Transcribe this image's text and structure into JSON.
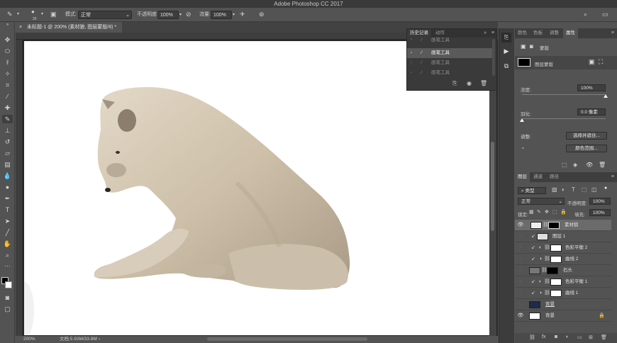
{
  "app": {
    "title": "Adobe Photoshop CC 2017"
  },
  "options": {
    "brush_size": "25",
    "mode_label": "模式:",
    "mode_value": "正常",
    "opacity_label": "不透明度:",
    "opacity_value": "100%",
    "flow_label": "流量:",
    "flow_value": "100%"
  },
  "document": {
    "tab_title": "未标题-1 @ 200% (素材狼, 图层蒙版/8) *",
    "zoom": "200%",
    "doc_info": "文档:5.93M/33.8M"
  },
  "history": {
    "tabs": [
      "历史记录",
      "动作"
    ],
    "items": [
      {
        "label": "画笔工具",
        "selected": false
      },
      {
        "label": "画笔工具",
        "selected": true
      },
      {
        "label": "画笔工具",
        "selected": false
      },
      {
        "label": "画笔工具",
        "selected": false
      }
    ]
  },
  "properties": {
    "tabs": [
      "颜色",
      "色板",
      "调整",
      "属性"
    ],
    "mask_title": "蒙版",
    "layer_mask_label": "图层蒙版",
    "density_label": "浓度:",
    "density_value": "100%",
    "feather_label": "羽化:",
    "feather_value": "0.0 像素",
    "adjust_label": "调整:",
    "select_and_mask": "选择并遮住...",
    "color_range": "颜色范围...",
    "density_level": 1.0,
    "feather_level": 0.0
  },
  "layers_panel": {
    "tabs": [
      "图层",
      "通道",
      "路径"
    ],
    "filter_kind": "类型",
    "blend_mode": "正常",
    "opacity_label": "不透明度:",
    "opacity_value": "100%",
    "lock_label": "锁定:",
    "fill_label": "填充:",
    "fill_value": "100%",
    "layers": [
      {
        "name": "素材狼",
        "visible": true,
        "selected": true
      },
      {
        "name": "图层 1",
        "visible": false,
        "selected": false
      },
      {
        "name": "色彩平衡 2",
        "visible": false,
        "selected": false
      },
      {
        "name": "曲线 2",
        "visible": false,
        "selected": false
      },
      {
        "name": "石头",
        "visible": false,
        "selected": false
      },
      {
        "name": "色彩平衡 1",
        "visible": false,
        "selected": false
      },
      {
        "name": "曲线 1",
        "visible": false,
        "selected": false
      },
      {
        "name": "背景",
        "visible": false,
        "selected": false
      },
      {
        "name": "背景",
        "visible": true,
        "selected": false
      }
    ]
  },
  "colors": {
    "accent": "#5a5a5a",
    "foreground": "#000000",
    "background": "#ffffff"
  }
}
